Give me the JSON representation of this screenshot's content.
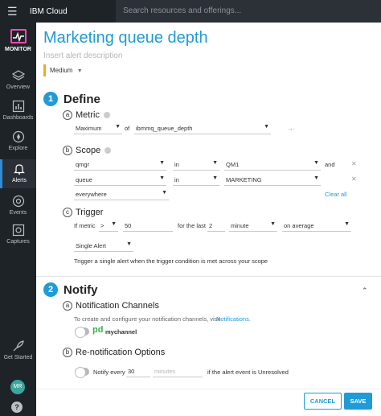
{
  "topbar": {
    "brand": "IBM Cloud",
    "search_placeholder": "Search resources and offerings..."
  },
  "sidebar": {
    "monitor": "MONITOR",
    "items": [
      {
        "label": "Overview",
        "icon": "layers-icon"
      },
      {
        "label": "Dashboards",
        "icon": "bar-chart-icon"
      },
      {
        "label": "Explore",
        "icon": "compass-icon"
      },
      {
        "label": "Alerts",
        "icon": "bell-icon",
        "active": true
      },
      {
        "label": "Events",
        "icon": "events-icon"
      },
      {
        "label": "Captures",
        "icon": "capture-icon"
      }
    ],
    "get_started": "Get Started",
    "avatar": "MR",
    "help": "?"
  },
  "page": {
    "title": "Marketing queue depth",
    "description_placeholder": "Insert alert description",
    "severity": "Medium",
    "severity_color": "#f5a623"
  },
  "define": {
    "number": "1",
    "title": "Define",
    "metric": {
      "letter": "a",
      "label": "Metric",
      "aggregation": "Maximum",
      "of_label": "of",
      "metric_name": "ibmmq_queue_depth",
      "extra": "→·"
    },
    "scope": {
      "letter": "b",
      "label": "Scope",
      "rows": [
        {
          "key": "qmgr",
          "op": "in",
          "value": "QM1",
          "join": "and"
        },
        {
          "key": "queue",
          "op": "in",
          "value": "MARKETING",
          "join": ""
        }
      ],
      "everywhere": "everywhere",
      "clear_all": "Clear all"
    },
    "trigger": {
      "letter": "c",
      "label": "Trigger",
      "if_metric": "If metric",
      "comparator": ">",
      "threshold": "50",
      "for_last": "for the last",
      "duration": "2",
      "unit": "minute",
      "mode": "on average",
      "alert_type": "Single Alert",
      "explanation": "Trigger a single alert when the trigger condition is met across your scope"
    }
  },
  "notify": {
    "number": "2",
    "title": "Notify",
    "channels": {
      "letter": "a",
      "label": "Notification Channels",
      "help_text": "To create and configure your notification channels, visit",
      "help_link": "Notifications.",
      "channel_logo": "pd",
      "channel_name": "mychannel"
    },
    "renotify": {
      "letter": "b",
      "label": "Re-notification Options",
      "notify_every": "Notify every",
      "interval": "30",
      "unit_placeholder": "minutes",
      "condition": "if the alert event is Unresolved"
    }
  },
  "footer": {
    "cancel": "CANCEL",
    "save": "SAVE"
  }
}
